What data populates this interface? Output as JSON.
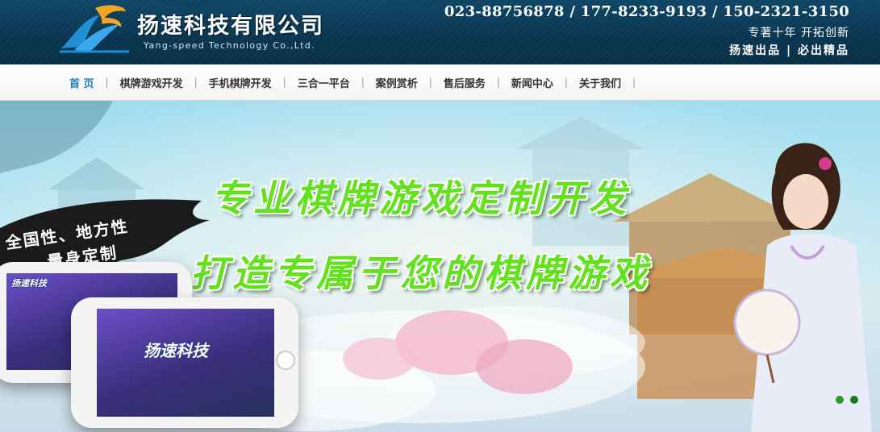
{
  "header": {
    "company_name": "扬速科技有限公司",
    "company_en": "Yang-speed  Technology  Co.,Ltd.",
    "phones": "023-88756878 / 177-8233-9193 / 150-2321-3150",
    "slogan1": "专著十年  开拓创新",
    "slogan2": "扬速出品 | 必出精品"
  },
  "nav": {
    "items": [
      {
        "label": "首 页"
      },
      {
        "label": "棋牌游戏开发"
      },
      {
        "label": "手机棋牌开发"
      },
      {
        "label": "三合一平台"
      },
      {
        "label": "案例赏析"
      },
      {
        "label": "售后服务"
      },
      {
        "label": "新闻中心"
      },
      {
        "label": "关于我们"
      }
    ],
    "separator": "|"
  },
  "banner": {
    "headline1": "专业棋牌游戏定制开发",
    "headline2": "打造专属于您的棋牌游戏",
    "brush_line1": "全国性、地方性",
    "brush_line2": "量身定制",
    "phone_logo_large": "扬速科技",
    "phone_logo_small": "扬速科技"
  },
  "colors": {
    "header_bg": "#0a3550",
    "nav_active": "#1a7fbf",
    "headline_green": "#63e11e"
  }
}
